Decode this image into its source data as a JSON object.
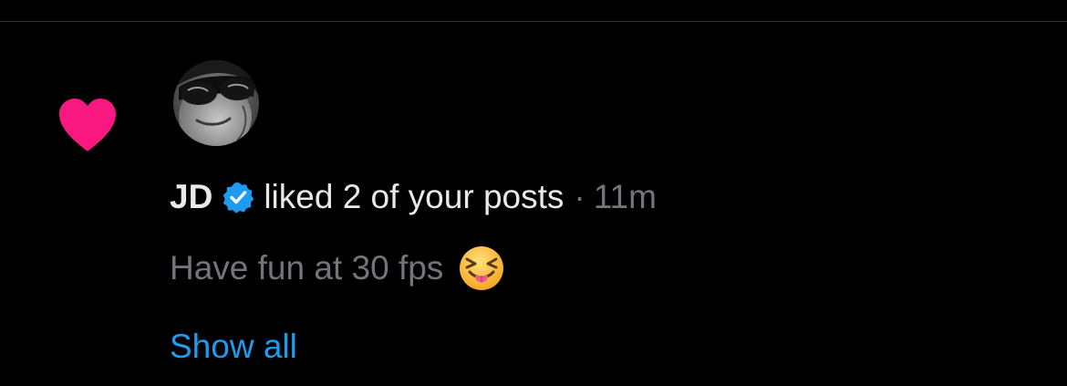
{
  "notification": {
    "type_icon": "heart-icon",
    "avatar_icon": "avatar-sunglasses",
    "user": {
      "name": "JD",
      "verified_icon": "verified-badge-icon"
    },
    "action": "liked 2 of your posts",
    "separator": "·",
    "timestamp": "11m",
    "post_snippet": "Have fun at 30 fps",
    "snippet_emoji_icon": "squinting-face-with-tongue-emoji",
    "show_all_label": "Show all"
  },
  "colors": {
    "background": "#000000",
    "heart": "#f91880",
    "verified": "#1d9bf0",
    "link": "#1d9bf0",
    "primary_text": "#e7e9ea",
    "secondary_text": "#71767b",
    "divider": "#2f3336"
  }
}
